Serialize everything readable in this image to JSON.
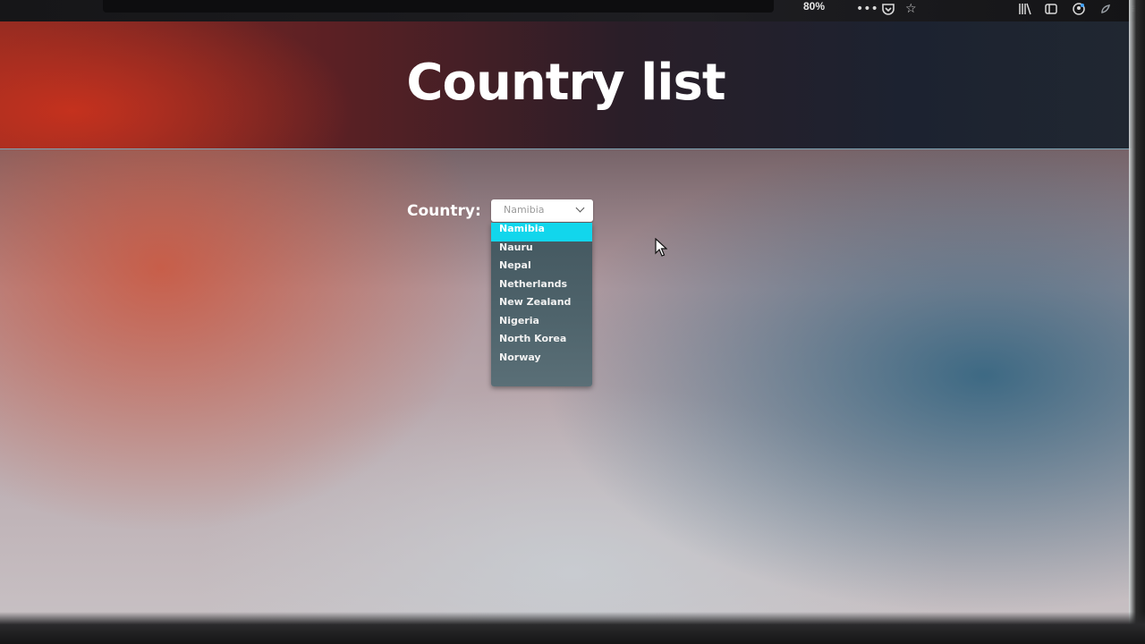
{
  "browser": {
    "zoom": "80%",
    "icons": [
      "more-icon",
      "pocket-icon",
      "bookmark-star-icon",
      "library-icon",
      "sidebar-icon",
      "account-icon",
      "extension-icon",
      "menu-icon"
    ]
  },
  "page": {
    "title": "Country list"
  },
  "form": {
    "country_label": "Country:",
    "country_select": {
      "value": "Namibia",
      "options": [
        "Namibia",
        "Nauru",
        "Nepal",
        "Netherlands",
        "New Zealand",
        "Nigeria",
        "North Korea",
        "Norway"
      ],
      "highlighted": "Namibia"
    }
  },
  "colors": {
    "highlight": "#12d6ec",
    "dropdown_bg": "#4b5f67",
    "title_text": "#ffffff"
  }
}
